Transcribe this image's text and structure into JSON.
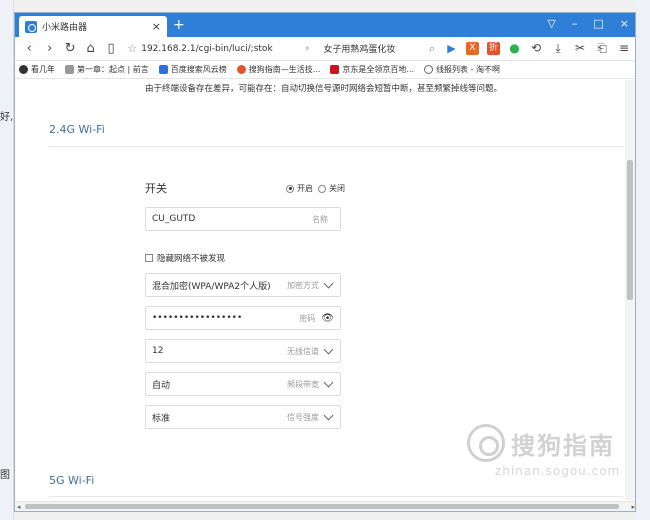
{
  "background": {
    "left_snippets": [
      "好,",
      "图"
    ]
  },
  "browser": {
    "tab_title": "小米路由器",
    "tab_close": "×",
    "new_tab": "+",
    "window_controls": [
      "▽",
      "–",
      "□",
      "×"
    ],
    "nav": {
      "back": "‹",
      "forward": "›",
      "reload": "↻",
      "home": "⌂",
      "reader": "▯"
    },
    "url": "192.168.2.1/cgi-bin/luci/;stok",
    "addr_sep": "›",
    "search_text": "女子用熟鸡蛋化妆",
    "search_icon": "⌕",
    "toolbar_extra": [
      "▶",
      "X",
      "折",
      "●",
      "⟲",
      "⤓",
      "✂",
      "⎗",
      "≡"
    ],
    "bookmarks": [
      {
        "label": "看几年",
        "color": "#333333"
      },
      {
        "label": "第一章：起点 | 前言",
        "color": "#999999"
      },
      {
        "label": "百度搜索风云榜",
        "color": "#2f6fd6"
      },
      {
        "label": "搜狗指南—生活技...",
        "color": "#e2542b"
      },
      {
        "label": "京东是全领京百地...",
        "color": "#c9151e"
      },
      {
        "label": "线报列表 - 淘不啊",
        "color": "#666666"
      }
    ]
  },
  "page": {
    "notice": "由于终端设备存在差异，可能存在：自动切换信号源时网络会短暂中断，甚至频繁掉线等问题。",
    "section_24g": "2.4G Wi-Fi",
    "section_5g": "5G Wi-Fi",
    "switch_label": "开关",
    "radio_on": "开启",
    "radio_off": "关闭",
    "ssid": {
      "value": "CU_GUTD",
      "hint": "名称"
    },
    "hide_network": "隐藏网络不被发现",
    "encryption": {
      "value": "混合加密(WPA/WPA2个人版)",
      "hint": "加密方式"
    },
    "password": {
      "value": "•••••••••••••••••",
      "hint": "密码"
    },
    "channel": {
      "value": "12",
      "hint": "无线信道"
    },
    "bandwidth": {
      "value": "自动",
      "hint": "频段带宽"
    },
    "signal": {
      "value": "标准",
      "hint": "信号强度"
    }
  },
  "watermark": {
    "main": "搜狗指南",
    "sub": "zhinan.sogou.com"
  },
  "colors": {
    "tab_bar": "#2f7fd6",
    "section_title": "#3f6f9a"
  }
}
